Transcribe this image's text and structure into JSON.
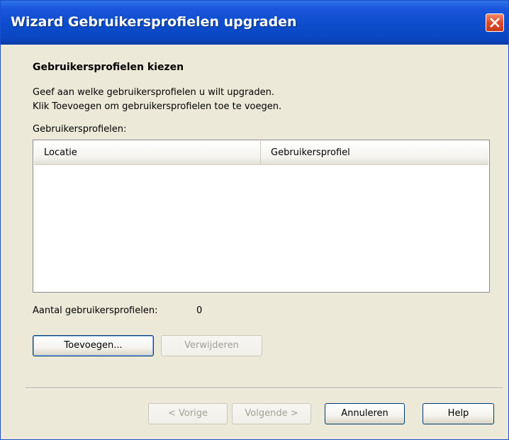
{
  "window": {
    "title": "Wizard Gebruikersprofielen upgraden",
    "close_icon": "close-icon",
    "accent_color": "#0c4ccc"
  },
  "page": {
    "heading": "Gebruikersprofielen kiezen",
    "description_line1": "Geef aan welke gebruikersprofielen u wilt upgraden.",
    "description_line2": "Klik Toevoegen om gebruikersprofielen toe te voegen.",
    "list_label": "Gebruikersprofielen:"
  },
  "list": {
    "columns": [
      "Locatie",
      "Gebruikersprofiel"
    ],
    "rows": []
  },
  "count": {
    "label": "Aantal gebruikersprofielen:",
    "value": "0"
  },
  "actions": {
    "add_label": "Toevoegen...",
    "remove_label": "Verwijderen"
  },
  "footer": {
    "back_label": "< Vorige",
    "next_label": "Volgende >",
    "cancel_label": "Annuleren",
    "help_label": "Help"
  }
}
